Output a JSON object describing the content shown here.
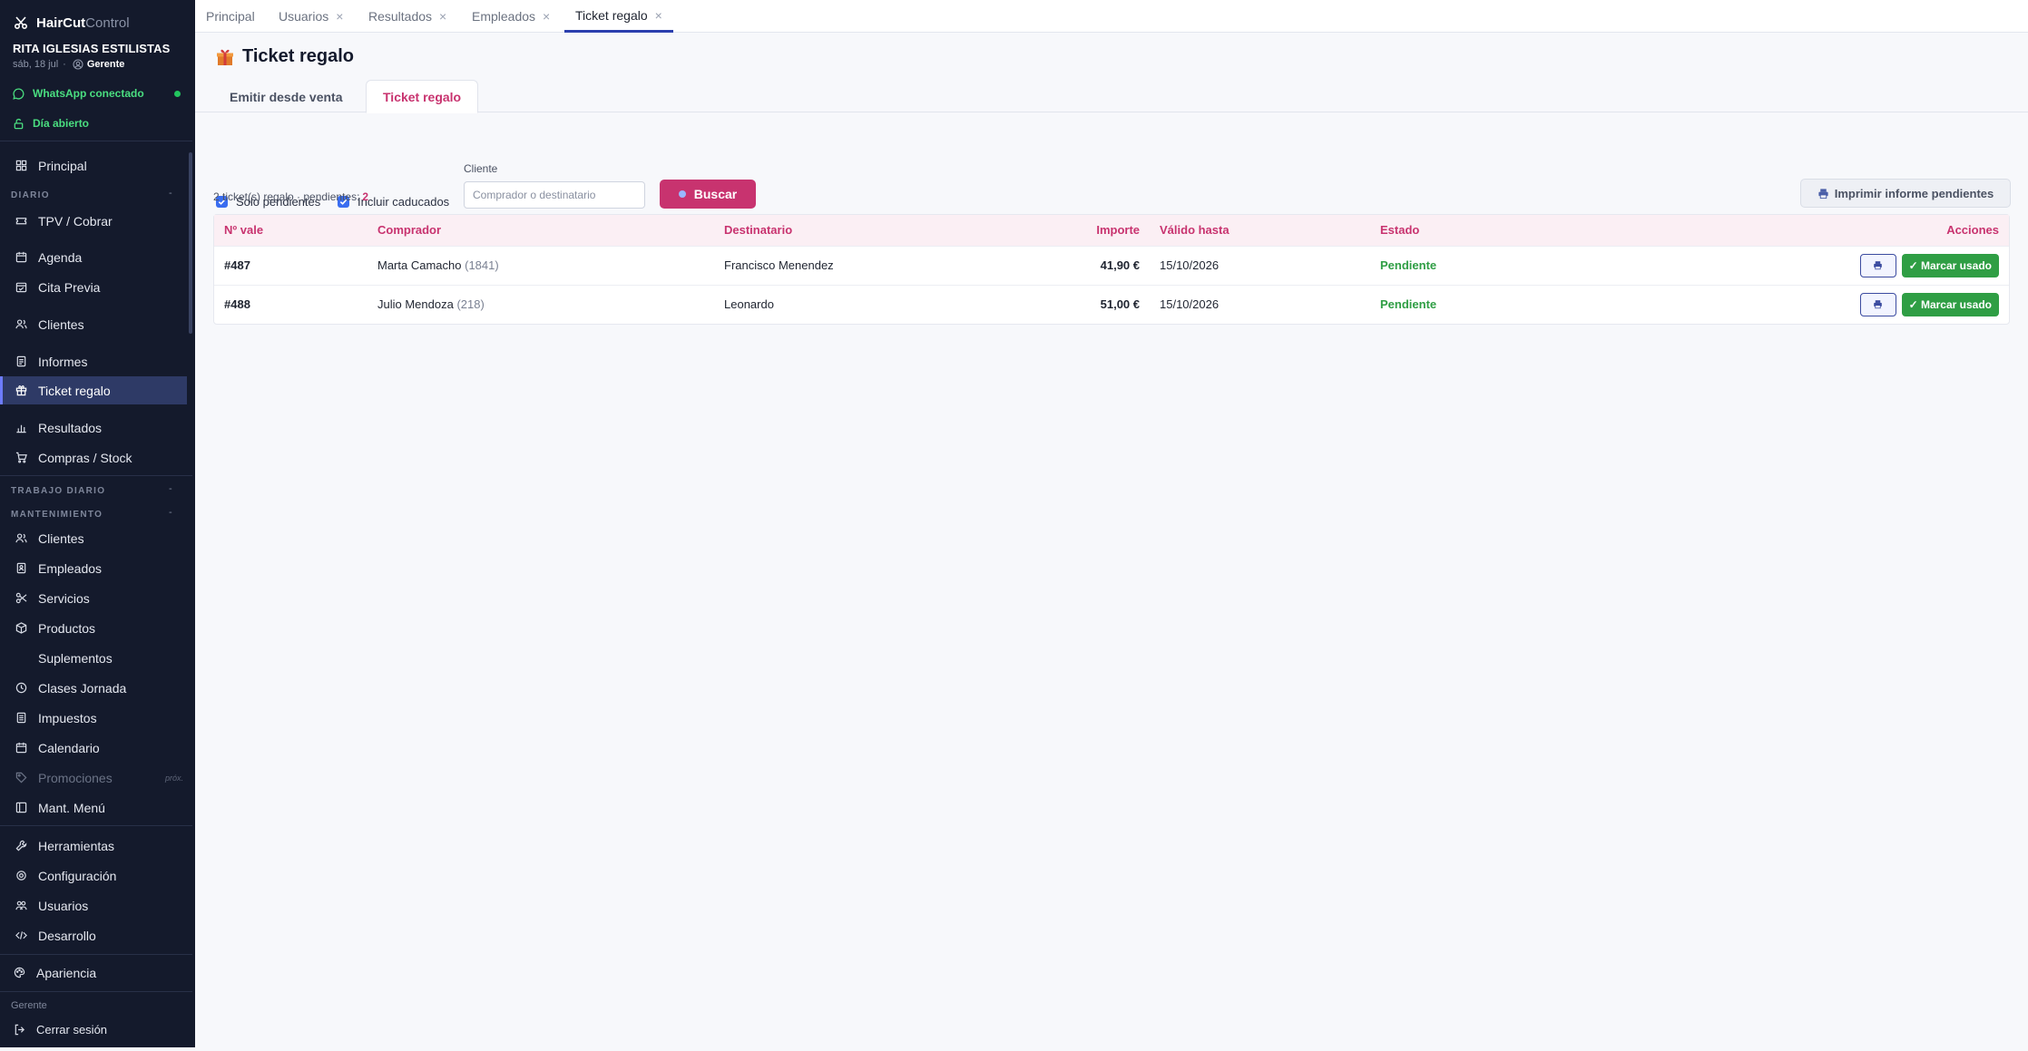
{
  "app": {
    "brand_primary": "HairCut",
    "brand_secondary": "Control",
    "salon_name": "RITA IGLESIAS ESTILISTAS",
    "date": "sáb, 18 jul",
    "role": "Gerente"
  },
  "status": {
    "whatsapp": "WhatsApp conectado",
    "day": "Día abierto"
  },
  "sidebar": {
    "principal": "Principal",
    "diario_label": "DIARIO",
    "diario_items": [
      {
        "label": "TPV / Cobrar",
        "icon": "ticket-icon"
      },
      {
        "label": "Agenda",
        "icon": "calendar-icon"
      },
      {
        "label": "Cita Previa",
        "icon": "calendar-check-icon"
      },
      {
        "label": "Clientes",
        "icon": "users-icon"
      },
      {
        "label": "Informes",
        "icon": "report-icon"
      },
      {
        "label": "Ticket regalo",
        "icon": "gift-icon"
      },
      {
        "label": "Resultados",
        "icon": "chart-icon"
      },
      {
        "label": "Compras / Stock",
        "icon": "cart-icon"
      }
    ],
    "trabajo_label": "TRABAJO DIARIO",
    "mant_label": "MANTENIMIENTO",
    "mant_items": [
      {
        "label": "Clientes",
        "icon": "users-icon"
      },
      {
        "label": "Empleados",
        "icon": "id-card-icon"
      },
      {
        "label": "Servicios",
        "icon": "scissors-icon"
      },
      {
        "label": "Productos",
        "icon": "box-icon"
      },
      {
        "label": "Suplementos",
        "icon": ""
      },
      {
        "label": "Clases Jornada",
        "icon": "clock-icon"
      },
      {
        "label": "Impuestos",
        "icon": "receipt-icon"
      },
      {
        "label": "Calendario",
        "icon": "calendar-icon"
      },
      {
        "label": "Promociones",
        "icon": "tag-icon",
        "tag": "próx."
      },
      {
        "label": "Mant. Menú",
        "icon": "menu-layout-icon"
      }
    ],
    "tools_items": [
      {
        "label": "Herramientas",
        "icon": "wrench-icon"
      },
      {
        "label": "Configuración",
        "icon": "gear-icon"
      },
      {
        "label": "Usuarios",
        "icon": "user-group-icon"
      },
      {
        "label": "Desarrollo",
        "icon": "code-icon"
      }
    ],
    "appearance": "Apariencia",
    "footer_role": "Gerente",
    "logout": "Cerrar sesión"
  },
  "tabs": [
    {
      "label": "Principal",
      "closable": false
    },
    {
      "label": "Usuarios",
      "closable": true
    },
    {
      "label": "Resultados",
      "closable": true
    },
    {
      "label": "Empleados",
      "closable": true
    },
    {
      "label": "Ticket regalo",
      "closable": true,
      "active": true
    }
  ],
  "page": {
    "title": "Ticket regalo",
    "subtabs": [
      "Emitir desde venta",
      "Ticket regalo"
    ],
    "filters": {
      "solo_pendientes": "Solo pendientes",
      "incluir_caducados": "Incluir caducados",
      "cliente_label": "Cliente",
      "cliente_placeholder": "Comprador o destinatario",
      "search_button": "Buscar",
      "print_report": "Imprimir informe pendientes"
    },
    "summary_text": "2 ticket(s) regalo · pendientes:",
    "summary_count": "2"
  },
  "table": {
    "headers": [
      "Nº vale",
      "Comprador",
      "Destinatario",
      "Importe",
      "Válido hasta",
      "Estado",
      "Acciones"
    ],
    "rows": [
      {
        "num": "#487",
        "buyer": "Marta Camacho",
        "buyer_id": "(1841)",
        "recipient": "Francisco Menendez",
        "amount": "41,90 €",
        "valid": "15/10/2026",
        "status": "Pendiente",
        "action_label": "✓ Marcar usado"
      },
      {
        "num": "#488",
        "buyer": "Julio Mendoza",
        "buyer_id": "(218)",
        "recipient": "Leonardo",
        "amount": "51,00 €",
        "valid": "15/10/2026",
        "status": "Pendiente",
        "action_label": "✓ Marcar usado"
      }
    ]
  },
  "colors": {
    "sidebar_bg": "#141a2c",
    "accent": "#c8336f",
    "success": "#2f9e44",
    "active_tab": "#2b3fae"
  }
}
